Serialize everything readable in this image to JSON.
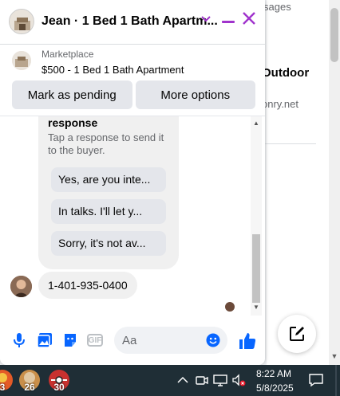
{
  "background": {
    "messages_fragment": "sages",
    "outdoor_heading": "Outdoor",
    "site_fragment": "onry.net"
  },
  "header": {
    "title": "Jean · 1 Bed 1 Bath Apartm...",
    "accent_color": "#a033cc"
  },
  "listing": {
    "source": "Marketplace",
    "title": "$500 - 1 Bed 1 Bath Apartment",
    "mark_pending": "Mark as pending",
    "more_options": "More options"
  },
  "bot": {
    "title": "response",
    "hint": "Tap a response to send it to the buyer.",
    "quick_replies": [
      "Yes, are you inte...",
      "In talks. I'll let y...",
      "Sorry, it's not av..."
    ]
  },
  "message": {
    "text": "1-401-935-0400"
  },
  "composer": {
    "placeholder": "Aa",
    "gif_label": "GIF",
    "accent_color": "#0866ff"
  },
  "taskbar": {
    "apps": [
      {
        "badge": "3",
        "color": "#e45a27"
      },
      {
        "badge": "26",
        "color": "#c98f4a"
      },
      {
        "badge": "30",
        "color": "#c8312f"
      }
    ],
    "time": "8:22 AM",
    "date": "5/8/2025"
  }
}
